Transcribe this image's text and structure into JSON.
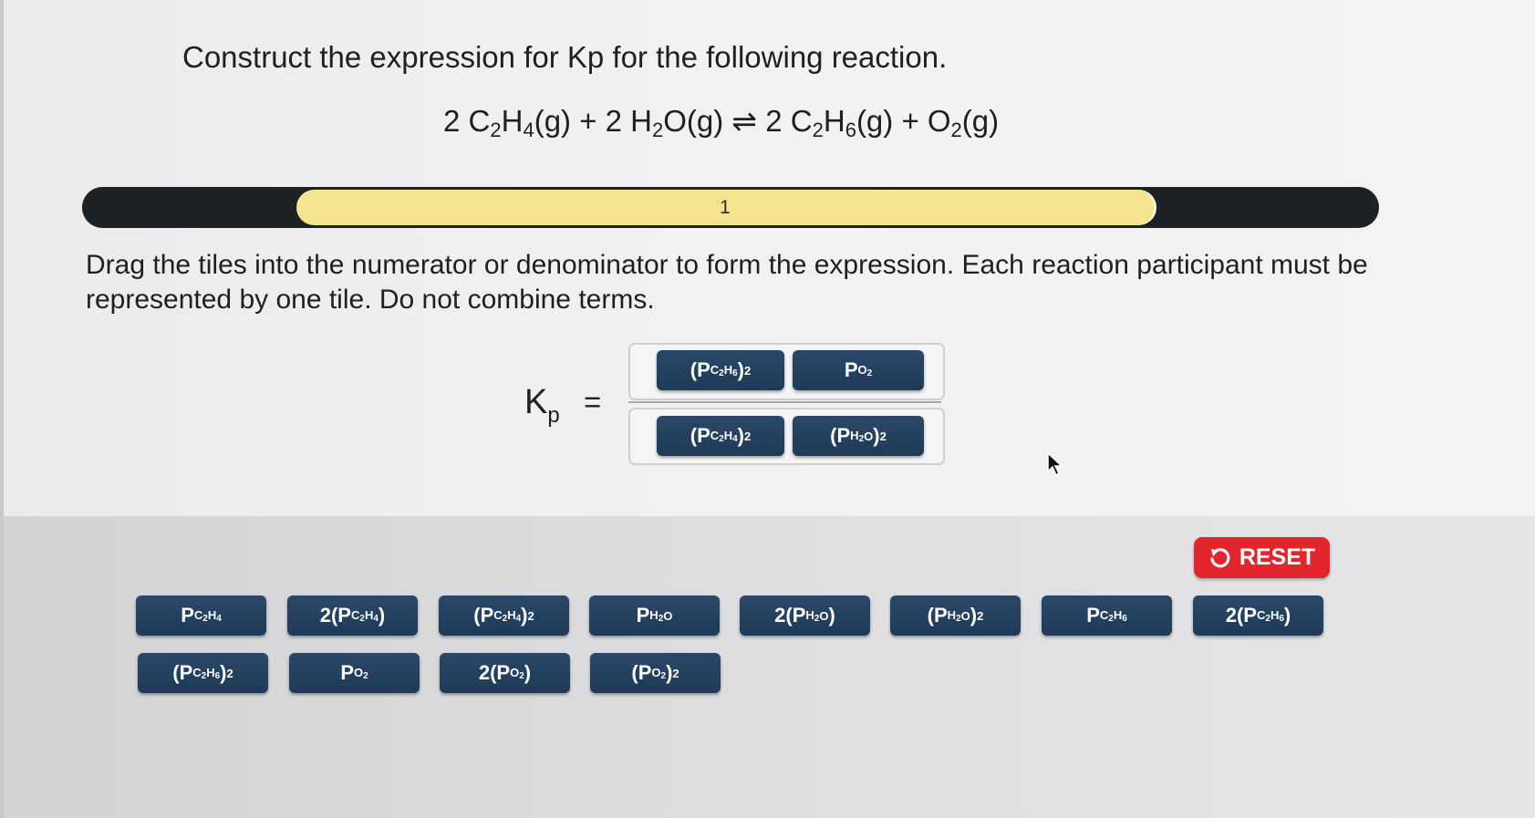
{
  "question": {
    "prompt": "Construct the expression for Kp for the following reaction.",
    "reaction": [
      {
        "t": "2 C"
      },
      {
        "s": "2"
      },
      {
        "t": "H"
      },
      {
        "s": "4"
      },
      {
        "t": "(g) + 2 H"
      },
      {
        "s": "2"
      },
      {
        "t": "O(g) ⇌ 2 C"
      },
      {
        "s": "2"
      },
      {
        "t": "H"
      },
      {
        "s": "6"
      },
      {
        "t": "(g) + O"
      },
      {
        "s": "2"
      },
      {
        "t": "(g)"
      }
    ]
  },
  "progress": {
    "label": "1",
    "fraction": 0.66
  },
  "instructions": "Drag the tiles into the numerator or denominator to form the expression. Each reaction participant must be represented by one tile. Do not combine terms.",
  "expression": {
    "lhs": "K",
    "lhs_sub": "p",
    "equals": "="
  },
  "numerator_tiles": [
    {
      "parts": [
        {
          "t": "(P"
        },
        {
          "s": "C",
          "ss": "2"
        },
        {
          "s": "H",
          "ss": "6"
        },
        {
          "t": ")"
        },
        {
          "p": "2"
        }
      ]
    },
    {
      "parts": [
        {
          "t": "P"
        },
        {
          "s": "O",
          "ss": "2"
        }
      ]
    }
  ],
  "denominator_tiles": [
    {
      "parts": [
        {
          "t": "(P"
        },
        {
          "s": "C",
          "ss": "2"
        },
        {
          "s": "H",
          "ss": "4"
        },
        {
          "t": ")"
        },
        {
          "p": "2"
        }
      ]
    },
    {
      "parts": [
        {
          "t": "(P"
        },
        {
          "s": "H",
          "ss": "2"
        },
        {
          "s": "O"
        },
        {
          "t": ")"
        },
        {
          "p": "2"
        }
      ]
    }
  ],
  "reset": {
    "label": "RESET"
  },
  "bank_row1": [
    {
      "parts": [
        {
          "t": "P"
        },
        {
          "s": "C",
          "ss": "2"
        },
        {
          "s": "H",
          "ss": "4"
        }
      ]
    },
    {
      "parts": [
        {
          "t": "2(P"
        },
        {
          "s": "C",
          "ss": "2"
        },
        {
          "s": "H",
          "ss": "4"
        },
        {
          "t": ")"
        }
      ]
    },
    {
      "parts": [
        {
          "t": "(P"
        },
        {
          "s": "C",
          "ss": "2"
        },
        {
          "s": "H",
          "ss": "4"
        },
        {
          "t": ")"
        },
        {
          "p": "2"
        }
      ]
    },
    {
      "parts": [
        {
          "t": "P"
        },
        {
          "s": "H",
          "ss": "2"
        },
        {
          "s": "O"
        }
      ]
    },
    {
      "parts": [
        {
          "t": "2(P"
        },
        {
          "s": "H",
          "ss": "2"
        },
        {
          "s": "O"
        },
        {
          "t": ")"
        }
      ]
    },
    {
      "parts": [
        {
          "t": "(P"
        },
        {
          "s": "H",
          "ss": "2"
        },
        {
          "s": "O"
        },
        {
          "t": ")"
        },
        {
          "p": "2"
        }
      ]
    },
    {
      "parts": [
        {
          "t": "P"
        },
        {
          "s": "C",
          "ss": "2"
        },
        {
          "s": "H",
          "ss": "6"
        }
      ]
    },
    {
      "parts": [
        {
          "t": "2(P"
        },
        {
          "s": "C",
          "ss": "2"
        },
        {
          "s": "H",
          "ss": "6"
        },
        {
          "t": ")"
        }
      ]
    }
  ],
  "bank_row2": [
    {
      "parts": [
        {
          "t": "(P"
        },
        {
          "s": "C",
          "ss": "2"
        },
        {
          "s": "H",
          "ss": "6"
        },
        {
          "t": ")"
        },
        {
          "p": "2"
        }
      ]
    },
    {
      "parts": [
        {
          "t": "P"
        },
        {
          "s": "O",
          "ss": "2"
        }
      ]
    },
    {
      "parts": [
        {
          "t": "2(P"
        },
        {
          "s": "O",
          "ss": "2"
        },
        {
          "t": ")"
        }
      ]
    },
    {
      "parts": [
        {
          "t": "(P"
        },
        {
          "s": "O",
          "ss": "2"
        },
        {
          "t": ")"
        },
        {
          "p": "2"
        }
      ]
    }
  ],
  "colors": {
    "tile": "#1e3a58",
    "reset": "#e3262e",
    "progress_fill": "#f3e58f",
    "progress_track": "#1d2227"
  },
  "icons": {
    "reset": "undo-arrow-icon",
    "cursor": "mouse-pointer-icon"
  }
}
